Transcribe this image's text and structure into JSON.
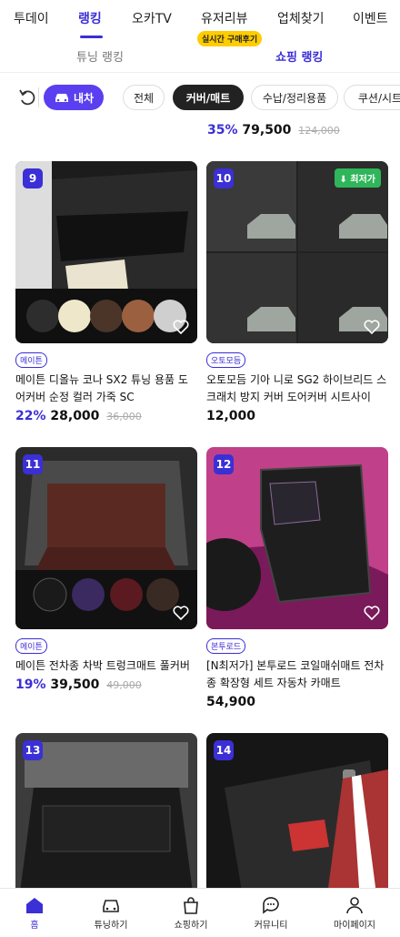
{
  "topnav": {
    "tabs": [
      "투데이",
      "랭킹",
      "오카TV",
      "유저리뷰",
      "업체찾기",
      "이벤트"
    ],
    "live_badge": "실시간 구매후기"
  },
  "subtabs": [
    "튜닝 랭킹",
    "쇼핑 랭킹"
  ],
  "filters": {
    "mycar": "내차",
    "chips": [
      "전체",
      "커버/매트",
      "수납/정리용품",
      "쿠션/시트"
    ]
  },
  "prev_item": {
    "discount": "35%",
    "price": "79,500",
    "original": "124,000"
  },
  "products": [
    {
      "rank": "9",
      "brand": "메이튼",
      "name": "메이튼 디올뉴 코나 SX2 튜닝 용품 도어커버 순정 컬러 가죽 SC",
      "discount": "22%",
      "price": "28,000",
      "original": "36,000",
      "badge": ""
    },
    {
      "rank": "10",
      "brand": "오토모듬",
      "name": "오토모듬 기아 니로 SG2 하이브리드 스크래치 방지 커버 도어커버 시트사이드...",
      "discount": "",
      "price": "12,000",
      "original": "",
      "badge": "최저가"
    },
    {
      "rank": "11",
      "brand": "메이튼",
      "name": "메이튼 전차종 차박 트렁크매트 풀커버",
      "discount": "19%",
      "price": "39,500",
      "original": "49,000",
      "badge": ""
    },
    {
      "rank": "12",
      "brand": "본투로드",
      "name": "[N최저가] 본투로드 코일매쉬매트 전차종 확장형 세트 자동차 카매트",
      "discount": "",
      "price": "54,900",
      "original": "",
      "badge": ""
    },
    {
      "rank": "13",
      "brand": "",
      "name": "",
      "discount": "",
      "price": "",
      "original": "",
      "badge": ""
    },
    {
      "rank": "14",
      "brand": "",
      "name": "",
      "discount": "",
      "price": "",
      "original": "",
      "badge": ""
    }
  ],
  "bottomnav": [
    "홈",
    "튜닝하기",
    "쇼핑하기",
    "커뮤니티",
    "마이페이지"
  ],
  "colors": {
    "accent": "#3b2fd6",
    "mycar": "#5a3ff0",
    "badge_green": "#2fb55a",
    "live": "#ffcc00"
  }
}
